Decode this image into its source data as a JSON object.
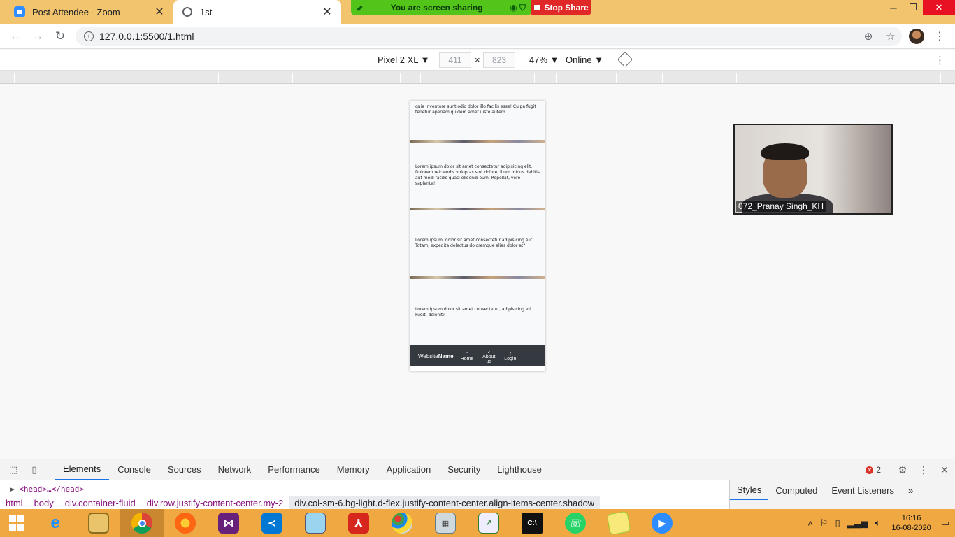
{
  "browser": {
    "tabs": [
      {
        "title": "Post Attendee - Zoom",
        "icon": "zoom-icon"
      },
      {
        "title": "1st",
        "icon": "globe-icon"
      }
    ],
    "url": "127.0.0.1:5500/1.html"
  },
  "screen_share": {
    "banner": "You are screen sharing",
    "stop_label": "Stop Share"
  },
  "device_toolbar": {
    "device": "Pixel 2 XL",
    "width": "411",
    "height": "823",
    "times": "×",
    "zoom": "47%",
    "network": "Online"
  },
  "page": {
    "card1_text": "quia inventore sunt odio dolor illo facilis esse! Culpa fugit tenetur aperiam quidem amet iusto autem.",
    "card2_text": "Lorem ipsum dolor sit amet consectetur adipisicing elit. Dolorem reiciendis voluptas sint dolore, illum minus debitis aut modi facilis quasi eligendi eum. Repellat, vero sapiente!",
    "card3_text": "Lorem ipsum, dolor sit amet consectetur adipisicing elit. Totam, expedita delectus doloremque alias dolor at?",
    "card4_text": "Lorem ipsum dolor sit amet consectetur, adipisicing elit. Fugit, deleniti!",
    "brand_a": "Website",
    "brand_b": "Name",
    "nav": [
      {
        "label": "Home",
        "icon": "home-icon"
      },
      {
        "label": "About us",
        "icon": "info-icon"
      },
      {
        "label": "Login",
        "icon": "arrow-up-icon"
      }
    ]
  },
  "zoom_video": {
    "participant": "072_Pranay Singh_KH"
  },
  "devtools": {
    "tabs": [
      "Elements",
      "Console",
      "Sources",
      "Network",
      "Performance",
      "Memory",
      "Application",
      "Security",
      "Lighthouse"
    ],
    "error_count": "2",
    "dom_line": "<head>…</head>",
    "breadcrumbs": [
      "html",
      "body",
      "div.container-fluid",
      "div.row.justify-content-center.my-2",
      "div.col-sm-6.bg-light.d-flex.justify-content-center.align-items-center.shadow"
    ],
    "styles_tabs": [
      "Styles",
      "Computed",
      "Event Listeners"
    ]
  },
  "taskbar": {
    "time": "16:16",
    "date": "16-08-2020"
  }
}
